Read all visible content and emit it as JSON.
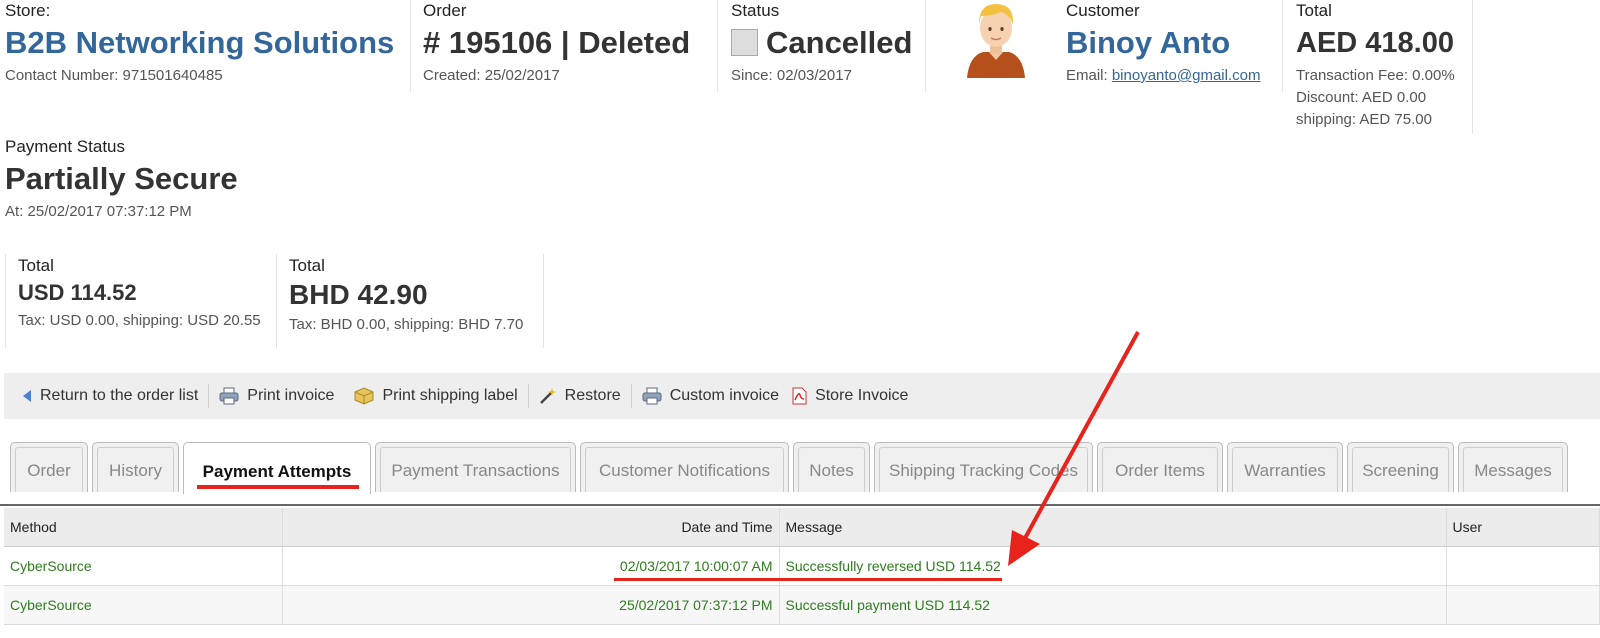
{
  "header": {
    "store": {
      "label": "Store:",
      "name": "B2B Networking Solutions",
      "contact": "Contact Number: 971501640485"
    },
    "order": {
      "label": "Order",
      "title": "# 195106 | Deleted",
      "created": "Created: 25/02/2017"
    },
    "status": {
      "label": "Status",
      "value": "Cancelled",
      "since": "Since: 02/03/2017"
    },
    "customer": {
      "label": "Customer",
      "name": "Binoy Anto",
      "email_prefix": "Email: ",
      "email": "binoyanto@gmail.com"
    },
    "total": {
      "label": "Total",
      "value": "AED 418.00",
      "fee": "Transaction Fee: 0.00%",
      "discount": "Discount: AED 0.00",
      "shipping": "shipping: AED 75.00"
    }
  },
  "payment_status": {
    "label": "Payment Status",
    "value": "Partially Secure",
    "at": "At: 25/02/2017 07:37:12 PM"
  },
  "totals": [
    {
      "label": "Total",
      "value": "USD 114.52",
      "detail": "Tax: USD 0.00, shipping: USD 20.55"
    },
    {
      "label": "Total",
      "value": "BHD 42.90",
      "detail": "Tax: BHD 0.00, shipping: BHD 7.70"
    }
  ],
  "toolbar": {
    "return": "Return to the order list",
    "print_invoice": "Print invoice",
    "print_shipping": "Print shipping label",
    "restore": "Restore",
    "custom_invoice": "Custom invoice",
    "store_invoice": "Store Invoice"
  },
  "tabs": [
    "Order",
    "History",
    "Payment Attempts",
    "Payment Transactions",
    "Customer Notifications",
    "Notes",
    "Shipping Tracking Codes",
    "Order Items",
    "Warranties",
    "Screening",
    "Messages"
  ],
  "table": {
    "headers": {
      "method": "Method",
      "datetime": "Date and Time",
      "message": "Message",
      "user": "User"
    },
    "rows": [
      {
        "method": "CyberSource",
        "datetime": "02/03/2017 10:00:07 AM",
        "message": "Successfully reversed USD 114.52",
        "user": ""
      },
      {
        "method": "CyberSource",
        "datetime": "25/02/2017 07:37:12 PM",
        "message": "Successful payment USD 114.52",
        "user": ""
      }
    ]
  },
  "colors": {
    "link": "#33669a",
    "success": "#2e7d1e",
    "annotation": "#e8231c"
  }
}
